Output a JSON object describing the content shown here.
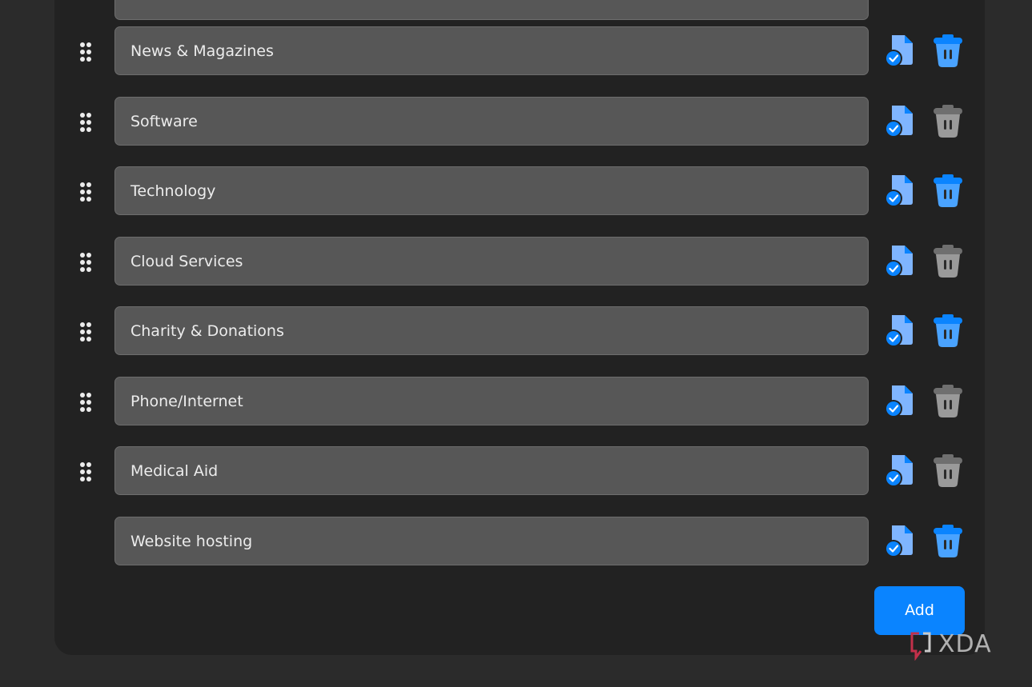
{
  "categories": [
    {
      "label": "News & Magazines",
      "draggable": true,
      "delete_enabled": true
    },
    {
      "label": "Software",
      "draggable": true,
      "delete_enabled": false
    },
    {
      "label": "Technology",
      "draggable": true,
      "delete_enabled": true
    },
    {
      "label": "Cloud Services",
      "draggable": true,
      "delete_enabled": false
    },
    {
      "label": "Charity & Donations",
      "draggable": true,
      "delete_enabled": true
    },
    {
      "label": "Phone/Internet",
      "draggable": true,
      "delete_enabled": false
    },
    {
      "label": "Medical Aid",
      "draggable": true,
      "delete_enabled": false
    },
    {
      "label": "Website hosting",
      "draggable": false,
      "delete_enabled": true
    }
  ],
  "actions": {
    "add_label": "Add"
  },
  "watermark": {
    "text": "XDA"
  },
  "colors": {
    "accent": "#0a84ff",
    "doc_light": "#7fb5ff",
    "trash_active": "#4aa3ff",
    "trash_inactive": "#9a9a9a",
    "field_bg": "#575757",
    "panel_bg": "#222222",
    "page_bg": "#2b2b2b"
  },
  "icons": {
    "drag": "drag-handle-icon",
    "doc": "document-check-icon",
    "trash": "trash-icon"
  }
}
